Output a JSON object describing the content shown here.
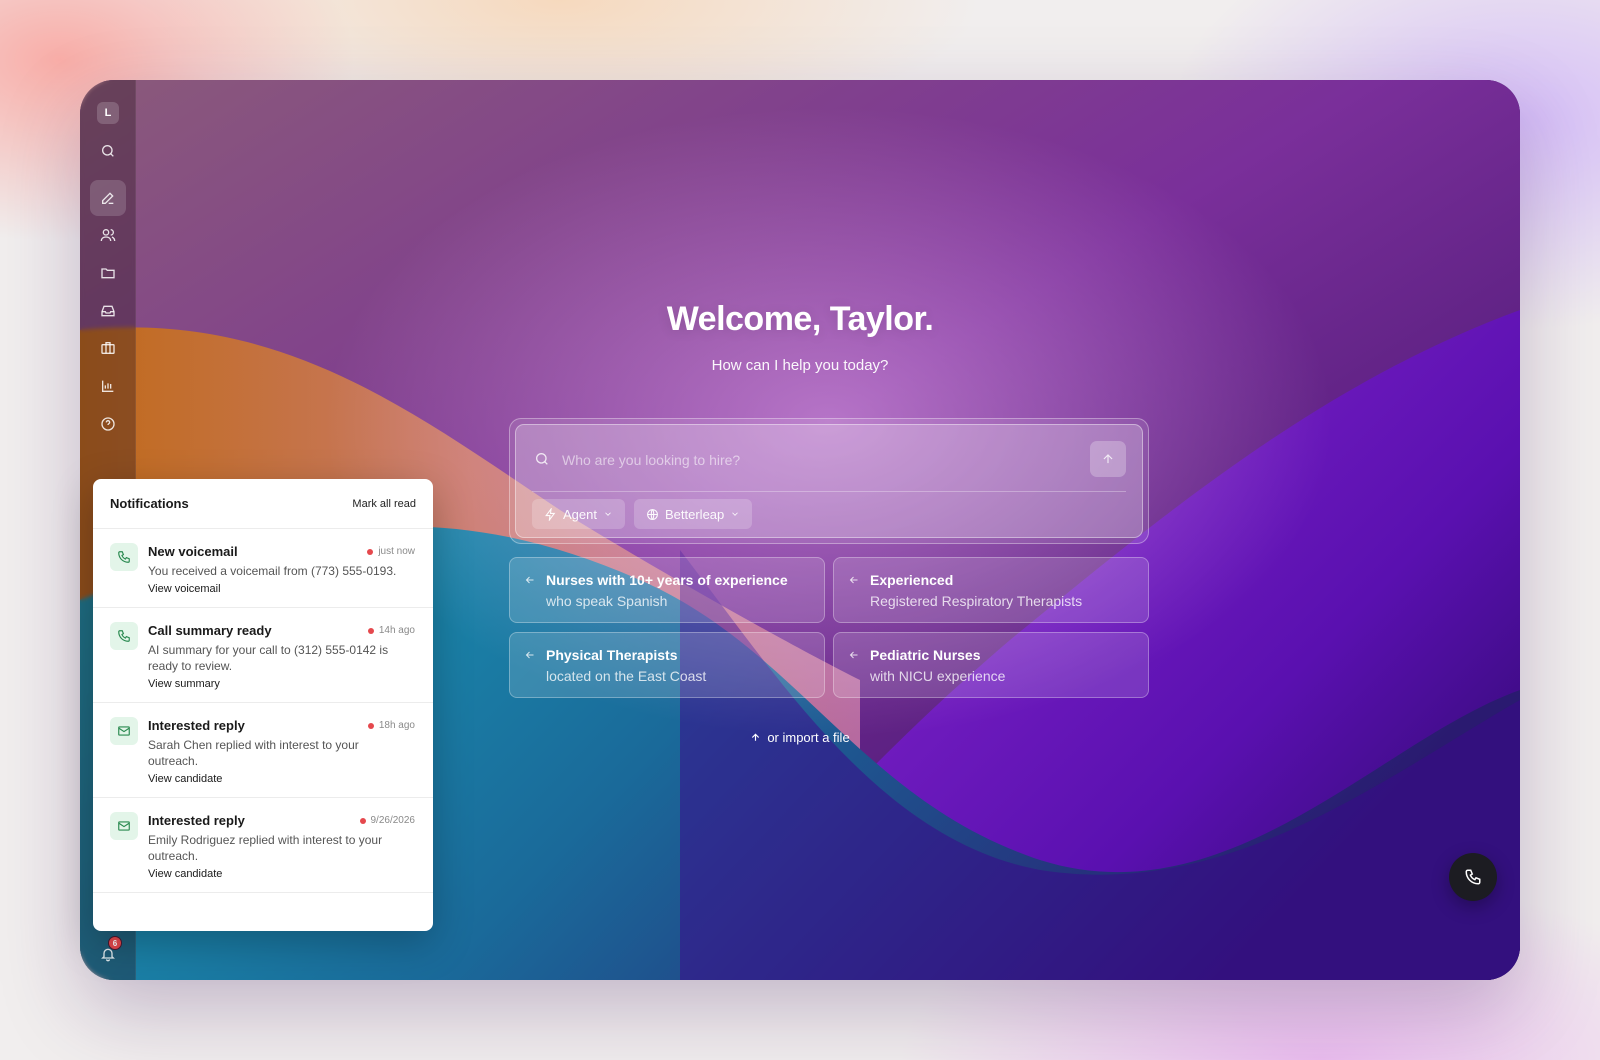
{
  "sidebar": {
    "logo": "L",
    "notification_count": "6"
  },
  "main": {
    "welcome": "Welcome, Taylor.",
    "subtitle": "How can I help you today?",
    "search_placeholder": "Who are you looking to hire?",
    "chips": [
      {
        "label": "Agent"
      },
      {
        "label": "Betterleap"
      }
    ],
    "suggestions": [
      {
        "title": "Nurses with 10+ years of experience",
        "subtitle": "who speak Spanish"
      },
      {
        "title": "Experienced",
        "subtitle": "Registered Respiratory Therapists"
      },
      {
        "title": "Physical Therapists",
        "subtitle": "located on the East Coast"
      },
      {
        "title": "Pediatric Nurses",
        "subtitle": "with NICU experience"
      }
    ],
    "import_label": "or import a file"
  },
  "notifications": {
    "title": "Notifications",
    "mark_all_read": "Mark all read",
    "items": [
      {
        "title": "New voicemail",
        "time": "just now",
        "body": "You received a voicemail from (773) 555-0193.",
        "link": "View voicemail",
        "icon": "phone-icon"
      },
      {
        "title": "Call summary ready",
        "time": "14h ago",
        "body": "AI summary for your call to (312) 555-0142 is ready to review.",
        "link": "View summary",
        "icon": "phone-icon"
      },
      {
        "title": "Interested reply",
        "time": "18h ago",
        "body": "Sarah Chen replied with interest to your outreach.",
        "link": "View candidate",
        "icon": "mail-icon"
      },
      {
        "title": "Interested reply",
        "time": "9/26/2026",
        "body": "Emily Rodriguez replied with interest to your outreach.",
        "link": "View candidate",
        "icon": "mail-icon"
      }
    ]
  },
  "colors": {
    "accent_green": "#2a8a50",
    "badge_red": "#e5484d"
  }
}
